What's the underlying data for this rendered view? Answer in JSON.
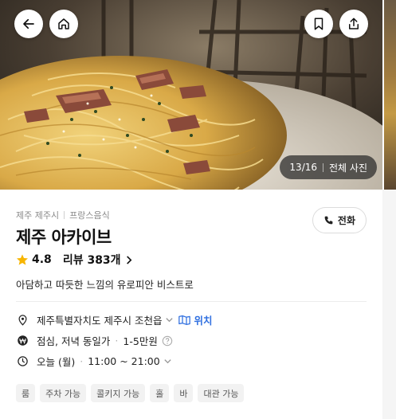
{
  "header": {
    "photo_index": "13/16",
    "all_photos_label": "전체 사진"
  },
  "nav": {
    "back": "back-icon",
    "home": "home-icon",
    "bookmark": "bookmark-icon",
    "share": "share-icon"
  },
  "place": {
    "region": "제주 제주시",
    "category": "프랑스음식",
    "name": "제주 아카이브",
    "call_label": "전화",
    "rating": "4.8",
    "reviews_label": "리뷰 383개",
    "description": "아담하고 따듯한 느낌의 유로피안 비스트로"
  },
  "details": {
    "address": "제주특별자치도 제주시 조천읍",
    "location_label": "위치",
    "meal_times": "점심, 저녁 동일가",
    "price_range": "1-5만원",
    "hours_day": "오늘 (월)",
    "hours_time": "11:00 ~ 21:00"
  },
  "tags": [
    "룸",
    "주차 가능",
    "콜키지 가능",
    "홀",
    "바",
    "대관 가능"
  ],
  "colors": {
    "accent_blue": "#2f6fe0",
    "star": "#f7b500",
    "counter_bg": "#282828"
  }
}
